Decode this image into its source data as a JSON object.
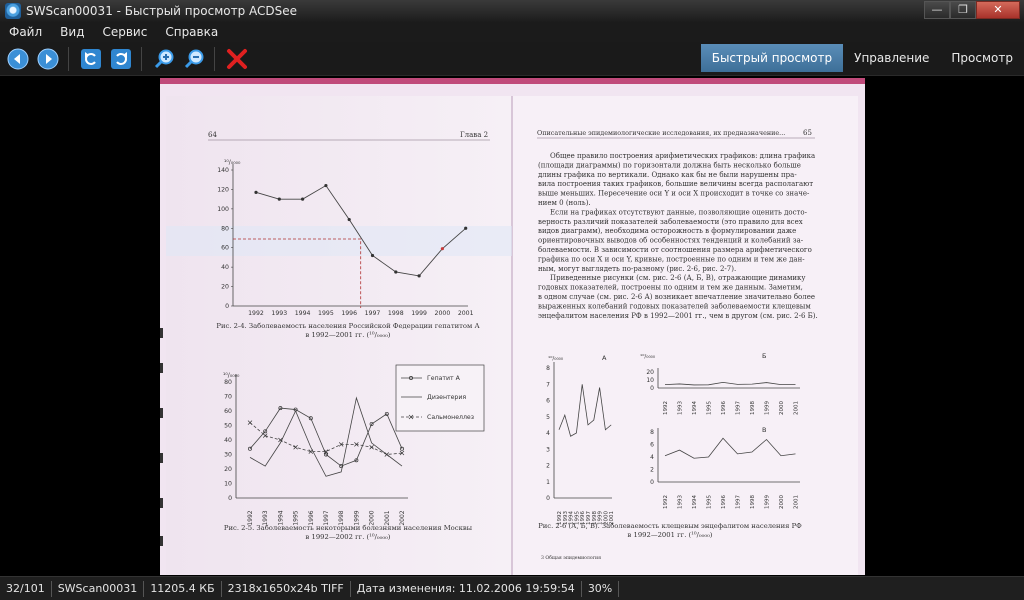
{
  "window": {
    "title": "SWScan00031 - Быстрый просмотр ACDSee",
    "minimize": "—",
    "maximize": "❐",
    "close": "✕"
  },
  "menu": {
    "items": [
      "Файл",
      "Вид",
      "Сервис",
      "Справка"
    ]
  },
  "modes": {
    "quick_view": "Быстрый просмотр",
    "manage": "Управление",
    "view": "Просмотр"
  },
  "status": {
    "index": "32/101",
    "filename": "SWScan00031",
    "size": "11205.4 КБ",
    "dimensions": "2318x1650x24b TIFF",
    "modified": "Дата изменения: 11.02.2006 19:59:54",
    "zoom": "30%"
  },
  "page": {
    "left_page_number": "64",
    "left_header": "Глава 2",
    "right_header": "Описательные эпидемиологические исследования, их предназначение...",
    "right_page_number": "65",
    "fig24_caption_1": "Рис. 2-4. Заболеваемость населения Российской Федерации гепатитом А",
    "fig24_caption_2": "в 1992—2001 гг. (¹⁰/₀₀₀₀)",
    "fig25_caption_1": "Рис. 2-5. Заболеваемость некоторыми болезнями населения Москвы",
    "fig25_caption_2": "в 1992—2002 гг. (¹⁰/₀₀₀₀)",
    "fig26_caption_1": "Рис. 2-6 (А, Б, В). Заболеваемость клещевым энцефалитом населения РФ",
    "fig26_caption_2": "в 1992—2001 гг. (¹⁰/₀₀₀₀)",
    "footer_note": "3 Общая эпидемиология",
    "paragraph_1": [
      "Общее правило построения арифметических графиков: длина графика",
      "(площади диаграммы) по горизонтали должна быть несколько больше",
      "длины графика по вертикали. Однако как бы не были нарушены пра-",
      "вила построения таких графиков, большие величины всегда располагают",
      "выше меньших. Пересечение оси Y и оси X происходит в точке со значе-",
      "нием 0 (ноль)."
    ],
    "paragraph_2": [
      "Если на графиках отсутствуют данные, позволяющие оценить досто-",
      "верность различий показателей заболеваемости (это правило для всех",
      "видов диаграмм), необходима осторожность в формулировании даже",
      "ориентировочных выводов об особенностях тенденций и колебаний за-",
      "болеваемости. В зависимости от соотношения размера арифметического",
      "графика по оси X и оси Y, кривые, построенные по одним и тем же дан-",
      "ным, могут выглядеть по-разному (рис. 2-6, рис. 2-7)."
    ],
    "paragraph_3": [
      "Приведенные рисунки (см. рис. 2-6 (А, Б, В), отражающие динамику",
      "годовых показателей, построены по одним и тем же данным. Заметим,",
      "в одном случае (см. рис. 2-6 А) возникает впечатление значительно более",
      "выраженных колебаний годовых показателей заболеваемости клещевым",
      "энцефалитом населения РФ в 1992—2001 гг., чем в другом (см. рис. 2-6 Б)."
    ]
  },
  "fig24": {
    "y_unit": "¹⁰/₀₀₀₀",
    "years": [
      "1992",
      "1993",
      "1994",
      "1995",
      "1996",
      "1997",
      "1998",
      "1999",
      "2000",
      "2001"
    ],
    "values": [
      117,
      110,
      110,
      124,
      89,
      52,
      35,
      31,
      59,
      80
    ],
    "ylim": [
      0,
      140
    ],
    "yticks": [
      "0",
      "20",
      "40",
      "60",
      "80",
      "100",
      "120",
      "140"
    ]
  },
  "fig25": {
    "y_unit": "¹⁰/₀₀₀₀",
    "years": [
      "1992",
      "1993",
      "1994",
      "1995",
      "1996",
      "1997",
      "1998",
      "1999",
      "2000",
      "2001",
      "2002"
    ],
    "ylim": [
      0,
      80
    ],
    "yticks": [
      "0",
      "10",
      "20",
      "30",
      "40",
      "50",
      "60",
      "70",
      "80"
    ],
    "legend": [
      "Гепатит А",
      "Дизентерия",
      "Сальмонеллез"
    ],
    "series": [
      {
        "name": "Гепатит А",
        "values": [
          34,
          46,
          62,
          61,
          55,
          30,
          22,
          26,
          51,
          58,
          34
        ]
      },
      {
        "name": "Дизентерия",
        "values": [
          28,
          22,
          38,
          60,
          35,
          15,
          18,
          69,
          38,
          30,
          22
        ]
      },
      {
        "name": "Сальмонеллез",
        "values": [
          52,
          43,
          40,
          35,
          32,
          32,
          37,
          37,
          35,
          30,
          31
        ]
      }
    ]
  },
  "fig26": {
    "y_unit": "¹⁰/₀₀₀₀",
    "label_a": "А",
    "label_b": "Б",
    "label_c": "В",
    "years": [
      "1992",
      "1993",
      "1994",
      "1995",
      "1996",
      "1997",
      "1998",
      "1999",
      "2000",
      "2001"
    ],
    "values": [
      4.2,
      5.1,
      3.8,
      4.0,
      7.0,
      4.5,
      4.8,
      6.8,
      4.2,
      4.5
    ],
    "a_yticks": [
      "0",
      "1",
      "2",
      "3",
      "4",
      "5",
      "6",
      "7",
      "8"
    ],
    "b_yticks": [
      "0",
      "10",
      "20"
    ],
    "c_yticks": [
      "0",
      "2",
      "4",
      "6",
      "8"
    ]
  },
  "chart_data": [
    {
      "type": "line",
      "x": [
        "1992",
        "1993",
        "1994",
        "1995",
        "1996",
        "1997",
        "1998",
        "1999",
        "2000",
        "2001"
      ],
      "series": [
        {
          "values": [
            117,
            110,
            110,
            124,
            89,
            52,
            35,
            31,
            59,
            80
          ]
        }
      ],
      "ylim": [
        0,
        140
      ],
      "ylabel": "¹⁰/₀₀₀₀"
    },
    {
      "type": "line",
      "x": [
        "1992",
        "1993",
        "1994",
        "1995",
        "1996",
        "1997",
        "1998",
        "1999",
        "2000",
        "2001",
        "2002"
      ],
      "series": [
        {
          "name": "Гепатит А",
          "values": [
            34,
            46,
            62,
            61,
            55,
            30,
            22,
            26,
            51,
            58,
            34
          ]
        },
        {
          "name": "Дизентерия",
          "values": [
            28,
            22,
            38,
            60,
            35,
            15,
            18,
            69,
            38,
            30,
            22
          ]
        },
        {
          "name": "Сальмонеллез",
          "values": [
            52,
            43,
            40,
            35,
            32,
            32,
            37,
            37,
            35,
            30,
            31
          ]
        }
      ],
      "ylim": [
        0,
        80
      ],
      "ylabel": "¹⁰/₀₀₀₀"
    },
    {
      "type": "line",
      "x": [
        "1992",
        "1993",
        "1994",
        "1995",
        "1996",
        "1997",
        "1998",
        "1999",
        "2000",
        "2001"
      ],
      "series": [
        {
          "values": [
            4.2,
            5.1,
            3.8,
            4.0,
            7.0,
            4.5,
            4.8,
            6.8,
            4.2,
            4.5
          ]
        }
      ],
      "ylim": [
        0,
        8
      ]
    }
  ]
}
